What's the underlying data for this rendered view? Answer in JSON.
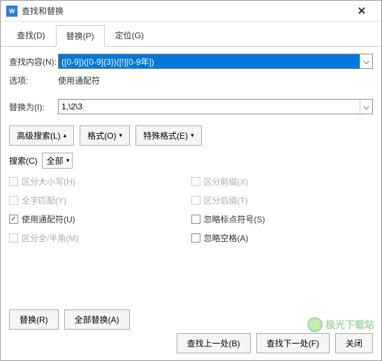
{
  "window": {
    "title": "查找和替换"
  },
  "tabs": {
    "find": "查找(D)",
    "replace": "替换(P)",
    "goto": "定位(G)"
  },
  "fields": {
    "find_label": "查找内容(N):",
    "find_value": "([0-9])([0-9]{3})([!][0-9年])",
    "options_label": "选项:",
    "options_value": "使用通配符",
    "replace_label": "替换为(I):",
    "replace_value": "1,\\2\\3"
  },
  "dropbtns": {
    "advanced": "高级搜索(L)",
    "format": "格式(O)",
    "special": "特殊格式(E)"
  },
  "scope": {
    "label": "搜索(C)",
    "value": "全部"
  },
  "checks": {
    "case": "区分大小写(H)",
    "whole": "全字匹配(Y)",
    "wildcard": "使用通配符(U)",
    "width": "区分全/半角(M)",
    "prefix": "区分前缀(X)",
    "suffix": "区分后缀(T)",
    "punct": "忽略标点符号(S)",
    "space": "忽略空格(A)"
  },
  "buttons": {
    "replace": "替换(R)",
    "replace_all": "全部替换(A)",
    "find_prev": "查找上一处(B)",
    "find_next": "查找下一处(F)",
    "close": "关闭"
  },
  "watermark": "极光下载站"
}
